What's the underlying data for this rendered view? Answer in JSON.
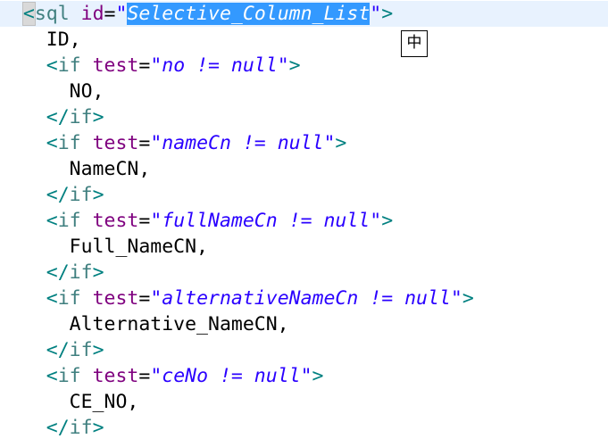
{
  "editor": {
    "lines": [
      {
        "indent": "  ",
        "tokens": [
          {
            "t": "<",
            "c": "punct bracket-match"
          },
          {
            "t": "sql",
            "c": "tagname"
          },
          {
            "t": " ",
            "c": "plain"
          },
          {
            "t": "id",
            "c": "attr"
          },
          {
            "t": "=",
            "c": "eq"
          },
          {
            "t": "\"",
            "c": "str"
          },
          {
            "t": "Selective_Column_List",
            "c": "sel"
          },
          {
            "t": "\"",
            "c": "str"
          },
          {
            "t": ">",
            "c": "punct"
          }
        ]
      },
      {
        "indent": "    ",
        "tokens": [
          {
            "t": "ID,",
            "c": "plain"
          }
        ]
      },
      {
        "indent": "    ",
        "tokens": [
          {
            "t": "<",
            "c": "punct"
          },
          {
            "t": "if",
            "c": "tagname"
          },
          {
            "t": " ",
            "c": "plain"
          },
          {
            "t": "test",
            "c": "attr"
          },
          {
            "t": "=",
            "c": "eq"
          },
          {
            "t": "\"no != null\"",
            "c": "str"
          },
          {
            "t": ">",
            "c": "punct"
          }
        ]
      },
      {
        "indent": "      ",
        "tokens": [
          {
            "t": "NO,",
            "c": "plain"
          }
        ]
      },
      {
        "indent": "    ",
        "tokens": [
          {
            "t": "</",
            "c": "punct"
          },
          {
            "t": "if",
            "c": "tagname"
          },
          {
            "t": ">",
            "c": "punct"
          }
        ]
      },
      {
        "indent": "    ",
        "tokens": [
          {
            "t": "<",
            "c": "punct"
          },
          {
            "t": "if",
            "c": "tagname"
          },
          {
            "t": " ",
            "c": "plain"
          },
          {
            "t": "test",
            "c": "attr"
          },
          {
            "t": "=",
            "c": "eq"
          },
          {
            "t": "\"nameCn != null\"",
            "c": "str"
          },
          {
            "t": ">",
            "c": "punct"
          }
        ]
      },
      {
        "indent": "      ",
        "tokens": [
          {
            "t": "NameCN,",
            "c": "plain"
          }
        ]
      },
      {
        "indent": "    ",
        "tokens": [
          {
            "t": "</",
            "c": "punct"
          },
          {
            "t": "if",
            "c": "tagname"
          },
          {
            "t": ">",
            "c": "punct"
          }
        ]
      },
      {
        "indent": "    ",
        "tokens": [
          {
            "t": "<",
            "c": "punct"
          },
          {
            "t": "if",
            "c": "tagname"
          },
          {
            "t": " ",
            "c": "plain"
          },
          {
            "t": "test",
            "c": "attr"
          },
          {
            "t": "=",
            "c": "eq"
          },
          {
            "t": "\"fullNameCn != null\"",
            "c": "str"
          },
          {
            "t": ">",
            "c": "punct"
          }
        ]
      },
      {
        "indent": "      ",
        "tokens": [
          {
            "t": "Full_NameCN,",
            "c": "plain"
          }
        ]
      },
      {
        "indent": "    ",
        "tokens": [
          {
            "t": "</",
            "c": "punct"
          },
          {
            "t": "if",
            "c": "tagname"
          },
          {
            "t": ">",
            "c": "punct"
          }
        ]
      },
      {
        "indent": "    ",
        "tokens": [
          {
            "t": "<",
            "c": "punct"
          },
          {
            "t": "if",
            "c": "tagname"
          },
          {
            "t": " ",
            "c": "plain"
          },
          {
            "t": "test",
            "c": "attr"
          },
          {
            "t": "=",
            "c": "eq"
          },
          {
            "t": "\"alternativeNameCn != null\"",
            "c": "str"
          },
          {
            "t": ">",
            "c": "punct"
          }
        ]
      },
      {
        "indent": "      ",
        "tokens": [
          {
            "t": "Alternative_NameCN,",
            "c": "plain"
          }
        ]
      },
      {
        "indent": "    ",
        "tokens": [
          {
            "t": "</",
            "c": "punct"
          },
          {
            "t": "if",
            "c": "tagname"
          },
          {
            "t": ">",
            "c": "punct"
          }
        ]
      },
      {
        "indent": "    ",
        "tokens": [
          {
            "t": "<",
            "c": "punct"
          },
          {
            "t": "if",
            "c": "tagname"
          },
          {
            "t": " ",
            "c": "plain"
          },
          {
            "t": "test",
            "c": "attr"
          },
          {
            "t": "=",
            "c": "eq"
          },
          {
            "t": "\"ceNo != null\"",
            "c": "str"
          },
          {
            "t": ">",
            "c": "punct"
          }
        ]
      },
      {
        "indent": "      ",
        "tokens": [
          {
            "t": "CE_NO,",
            "c": "plain"
          }
        ]
      },
      {
        "indent": "    ",
        "tokens": [
          {
            "t": "</",
            "c": "punct"
          },
          {
            "t": "if",
            "c": "tagname"
          },
          {
            "t": ">",
            "c": "punct"
          }
        ]
      }
    ]
  },
  "ime_indicator": {
    "label": "中"
  }
}
